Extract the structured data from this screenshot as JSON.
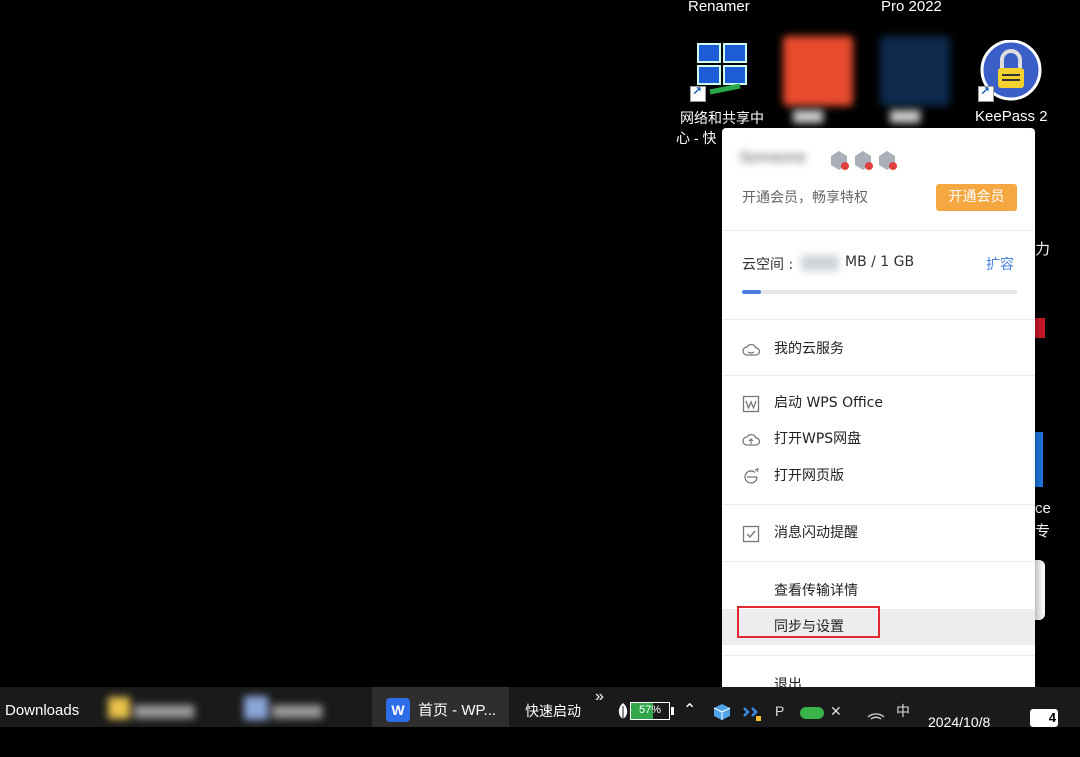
{
  "desktop": {
    "top_labels": [
      "Renamer",
      "Pro 2022"
    ],
    "icons": [
      {
        "label_line1": "网络和共享中",
        "label_line2": "心 - 快"
      },
      {
        "label_line1": "",
        "label_line2": ""
      },
      {
        "label_line1": "",
        "label_line2": ""
      },
      {
        "label_line1": "KeePass 2",
        "label_line2": ""
      }
    ],
    "edge_fragments": [
      "力",
      "ce",
      "专"
    ]
  },
  "popup": {
    "username": "Someone",
    "member_prompt": "开通会员，畅享特权",
    "member_button": "开通会员",
    "storage": {
      "label": "云空间 :",
      "used": "",
      "suffix": "MB / 1 GB",
      "expand": "扩容",
      "used_fraction": 0.07
    },
    "menu": {
      "cloud_service": "我的云服务",
      "launch_wps": "启动 WPS Office",
      "open_netdisk": "打开WPS网盘",
      "open_web": "打开网页版",
      "notify_flash": "消息闪动提醒",
      "transfer_details": "查看传输详情",
      "sync_settings": "同步与设置",
      "quit": "退出"
    }
  },
  "taskbar": {
    "downloads": "Downloads",
    "wps_tab": "首页 - WP...",
    "quick_launch": "快速启动",
    "chevron": "»",
    "battery": "57%",
    "date": "2024/10/8",
    "notification_count": "4"
  },
  "colors": {
    "accent": "#4a7fe0",
    "member_button_bg": "#f5a742",
    "highlight_border": "#e0282e"
  }
}
